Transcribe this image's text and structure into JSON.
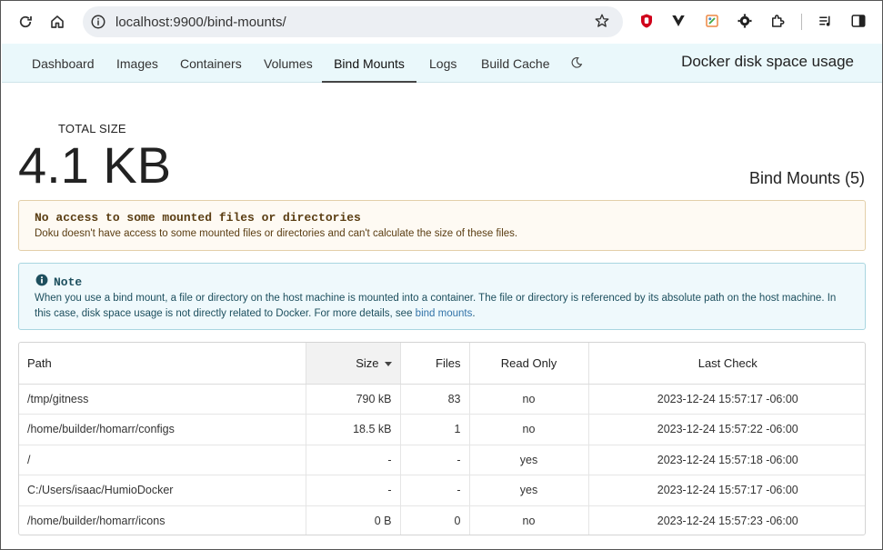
{
  "browser": {
    "url": "localhost:9900/bind-mounts/"
  },
  "nav": {
    "tabs": [
      {
        "label": "Dashboard"
      },
      {
        "label": "Images"
      },
      {
        "label": "Containers"
      },
      {
        "label": "Volumes"
      },
      {
        "label": "Bind Mounts",
        "active": true
      },
      {
        "label": "Logs"
      },
      {
        "label": "Build Cache"
      }
    ],
    "title": "Docker disk space usage"
  },
  "summary": {
    "total_label": "TOTAL SIZE",
    "total_value": "4.1 KB",
    "section_title": "Bind Mounts (5)"
  },
  "warning": {
    "title": "No access to some mounted files or directories",
    "text": "Doku doesn't have access to some mounted files or directories and can't calculate the size of these files."
  },
  "note": {
    "title": "Note",
    "text": "When you use a bind mount, a file or directory on the host machine is mounted into a container. The file or directory is referenced by its absolute path on the host machine. In this case, disk space usage is not directly related to Docker. For more details, see ",
    "link": "bind mounts",
    "text_end": "."
  },
  "table": {
    "headers": {
      "path": "Path",
      "size": "Size",
      "files": "Files",
      "read_only": "Read Only",
      "last_check": "Last Check"
    },
    "rows": [
      {
        "path": "/tmp/gitness",
        "size": "790 kB",
        "files": "83",
        "read_only": "no",
        "last_check": "2023-12-24  15:57:17 -06:00"
      },
      {
        "path": "/home/builder/homarr/configs",
        "size": "18.5 kB",
        "files": "1",
        "read_only": "no",
        "last_check": "2023-12-24  15:57:22 -06:00"
      },
      {
        "path": "/",
        "size": "-",
        "files": "-",
        "read_only": "yes",
        "last_check": "2023-12-24  15:57:18 -06:00"
      },
      {
        "path": "C:/Users/isaac/HumioDocker",
        "size": "-",
        "files": "-",
        "read_only": "yes",
        "last_check": "2023-12-24  15:57:17 -06:00"
      },
      {
        "path": "/home/builder/homarr/icons",
        "size": "0 B",
        "files": "0",
        "read_only": "no",
        "last_check": "2023-12-24  15:57:23 -06:00"
      }
    ]
  },
  "colors": {
    "nav_bg": "#eaf8fb",
    "warning_bg": "#fefaf3",
    "note_bg": "#eff9fc",
    "link": "#3273a8"
  }
}
